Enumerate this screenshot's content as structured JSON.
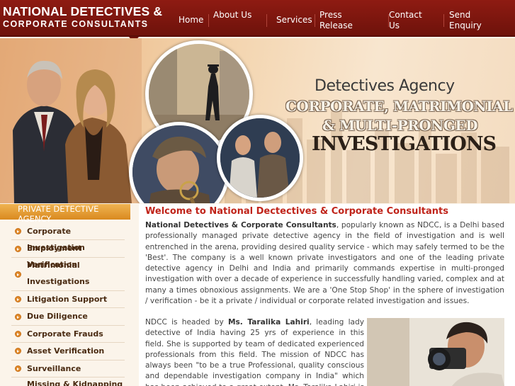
{
  "header": {
    "logo_line1": "NATIONAL DETECTIVES &",
    "logo_line2": "CORPORATE CONSULTANTS",
    "nav": [
      {
        "label": "Home"
      },
      {
        "label": "About Us"
      },
      {
        "label": "Services"
      },
      {
        "label": "Press Release"
      },
      {
        "label": "Contact Us"
      },
      {
        "label": "Send Enquiry"
      }
    ],
    "brand_color": "#8e1b12"
  },
  "banner": {
    "title": "Detectives Agency",
    "line1": "CORPORATE, MATRIMONIAL",
    "line2": "& MULTI-PRONGED",
    "line3": "INVESTIGATIONS"
  },
  "sidebar": {
    "heading": "PRIVATE DETECTIVE AGENCY",
    "items": [
      {
        "label": "Corporate Investigation"
      },
      {
        "label": "Employment Verification"
      },
      {
        "label": "Matrimonial Investigations"
      },
      {
        "label": "Litigation Support"
      },
      {
        "label": "Due Diligence"
      },
      {
        "label": "Corporate Frauds"
      },
      {
        "label": "Asset Verification"
      },
      {
        "label": "Surveillance"
      },
      {
        "label": "Missing & Kidnapping"
      }
    ],
    "accent": "#e08a2c"
  },
  "main": {
    "welcome": "Welcome to National Dectectives & Corporate Consultants",
    "p1_strong": "National Detectives & Corporate Consultants",
    "p1_text": ", popularly known as NDCC, is a Delhi based professionally managed private detective agency in the field of investigation and is well entrenched in the arena, providing desired quality service - which may safely termed to be the 'Best'. The company is a well known private investigators and one of the leading private detective agency in Delhi and India and primarily commands expertise in multi-pronged investigation with over a decade of experience in successfully handling varied, complex and at many a times obnoxious assignments. We are a 'One Stop Shop' in the sphere of investigation / verification - be it a private / individual or corporate related investigation and issues.",
    "p2_a": "NDCC is headed by ",
    "p2_strong": "Ms. Taralika Lahiri",
    "p2_b": ", leading lady detective of India having 25 yrs of experience in this field. She is supported by team of dedicated experienced professionals from this field. The mission of NDCC has always been \"to be a true Professional, quality conscious and dependable investigation company in India\" which has been achieved to a great extent. Ms. Taralika Lahiri is a Certified Professional's Trained Private"
  }
}
